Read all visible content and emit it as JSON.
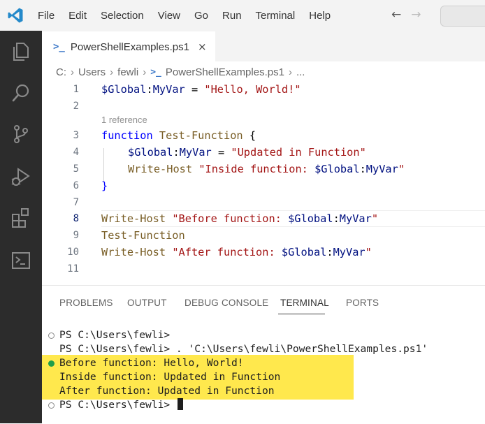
{
  "menu": [
    "File",
    "Edit",
    "Selection",
    "View",
    "Go",
    "Run",
    "Terminal",
    "Help"
  ],
  "nav": {
    "back": "←",
    "forward": "→"
  },
  "tab": {
    "icon": ">_",
    "name": "PowerShellExamples.ps1",
    "close": "×"
  },
  "breadcrumb": {
    "drive": "C:",
    "users": "Users",
    "user": "fewli",
    "file": "PowerShellExamples.ps1",
    "more": "..."
  },
  "editor": {
    "codelens": "1 reference",
    "line_numbers": [
      "1",
      "2",
      "3",
      "4",
      "5",
      "6",
      "7",
      "8",
      "9",
      "10",
      "11"
    ],
    "lines": {
      "l1": {
        "var": "$Global",
        "plain1": ":",
        "var2": "MyVar",
        "plain2": " = ",
        "str": "\"Hello, World!\""
      },
      "l3": {
        "kw": "function",
        "fn": " Test-Function",
        "plain": " {"
      },
      "l4": {
        "var": "$Global",
        "plain1": ":",
        "var2": "MyVar",
        "plain2": " = ",
        "str": "\"Updated in Function\""
      },
      "l5": {
        "fn": "Write-Host",
        "str": " \"Inside function: ",
        "var": "$Global",
        "plain": ":",
        "var2": "MyVar",
        "str2": "\""
      },
      "l6": {
        "plain": "}"
      },
      "l8": {
        "fn": "Write-Host",
        "str": " \"Before function: ",
        "var": "$Global",
        "plain": ":",
        "var2": "MyVar",
        "str2": "\""
      },
      "l9": {
        "fn": "Test-Function"
      },
      "l10": {
        "fn": "Write-Host",
        "str": " \"After function: ",
        "var": "$Global",
        "plain": ":",
        "var2": "MyVar",
        "str2": "\""
      }
    }
  },
  "panel": {
    "tabs": [
      "PROBLEMS",
      "OUTPUT",
      "DEBUG CONSOLE",
      "TERMINAL",
      "PORTS"
    ],
    "active_tab": "TERMINAL"
  },
  "terminal": [
    "PS C:\\Users\\fewli>",
    "PS C:\\Users\\fewli> . 'C:\\Users\\fewli\\PowerShellExamples.ps1'",
    "Before function: Hello, World!",
    "Inside function: Updated in Function",
    "After function: Updated in Function",
    "PS C:\\Users\\fewli>"
  ],
  "colors": {
    "highlight": "#ffe84d",
    "success_dot": "#1f9e4a",
    "activity_bar": "#2c2c2c"
  },
  "icons": [
    "vscode-logo-icon",
    "explorer-icon",
    "search-icon",
    "source-control-icon",
    "run-debug-icon",
    "extensions-icon",
    "terminal-icon",
    "powershell-icon"
  ]
}
